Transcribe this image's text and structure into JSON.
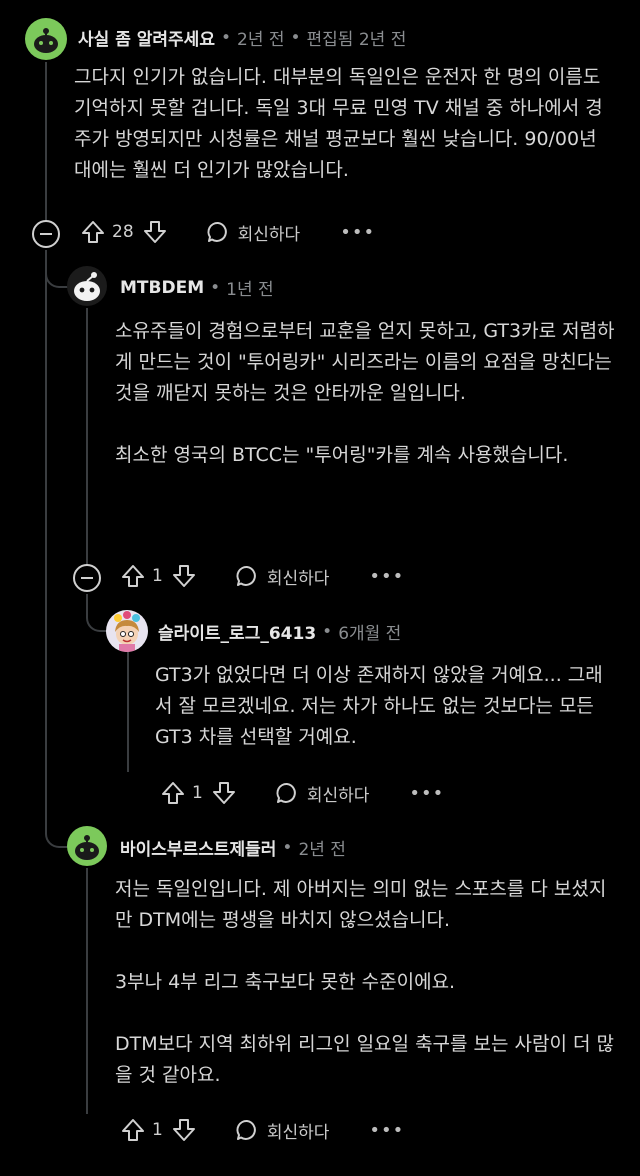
{
  "comments": [
    {
      "author": "사실 좀 알려주세요",
      "dot": "•",
      "time": "2년 전",
      "dot2": "•",
      "edited": "편집됨 2년 전",
      "paragraphs": [
        "그다지 인기가 없습니다. 대부분의 독일인은 운전자 한 명의 이름도 기억하지 못할 겁니다. 독일 3대 무료 민영 TV 채널 중 하나에서 경주가 방영되지만 시청률은 채널 평균보다 훨씬 낮습니다. 90/00년대에는 훨씬 더 인기가 많았습니다."
      ],
      "votes": "28",
      "reply": "회신하다",
      "more": "•••"
    },
    {
      "author": "MTBDEM",
      "dot": "•",
      "time": "1년 전",
      "paragraphs": [
        "소유주들이 경험으로부터 교훈을 얻지 못하고, GT3카로 저렴하게 만드는 것이 \"투어링카\" 시리즈라는 이름의 요점을 망친다는 것을 깨닫지 못하는 것은 안타까운 일입니다.",
        "최소한 영국의 BTCC는 \"투어링\"카를 계속 사용했습니다."
      ],
      "votes": "1",
      "reply": "회신하다",
      "more": "•••"
    },
    {
      "author": "슬라이트_로그_6413",
      "dot": "•",
      "time": "6개월 전",
      "paragraphs": [
        "GT3가 없었다면 더 이상 존재하지 않았을 거예요... 그래서 잘 모르겠네요. 저는 차가 하나도 없는 것보다는 모든 GT3 차를 선택할 거예요."
      ],
      "votes": "1",
      "reply": "회신하다",
      "more": "•••"
    },
    {
      "author": "바이스부르스트제들러",
      "dot": "•",
      "time": "2년 전",
      "paragraphs": [
        "저는 독일인입니다. 제 아버지는 의미 없는 스포츠를 다 보셨지만 DTM에는 평생을 바치지 않으셨습니다.",
        "3부나 4부 리그 축구보다 못한 수준이에요.",
        "DTM보다 지역 최하위 리그인 일요일 축구를 보는 사람이 더 많을 것 같아요."
      ],
      "votes": "1",
      "reply": "회신하다",
      "more": "•••"
    }
  ],
  "colors": {
    "background": "#000000",
    "avatar_green": "#7cc95b",
    "thread_line": "#3a3d40",
    "meta_gray": "#8a8d90"
  },
  "icons": [
    "collapse-icon",
    "upvote-icon",
    "downvote-icon",
    "reply-bubble-icon",
    "more-icon",
    "snoo-avatar-icon"
  ]
}
